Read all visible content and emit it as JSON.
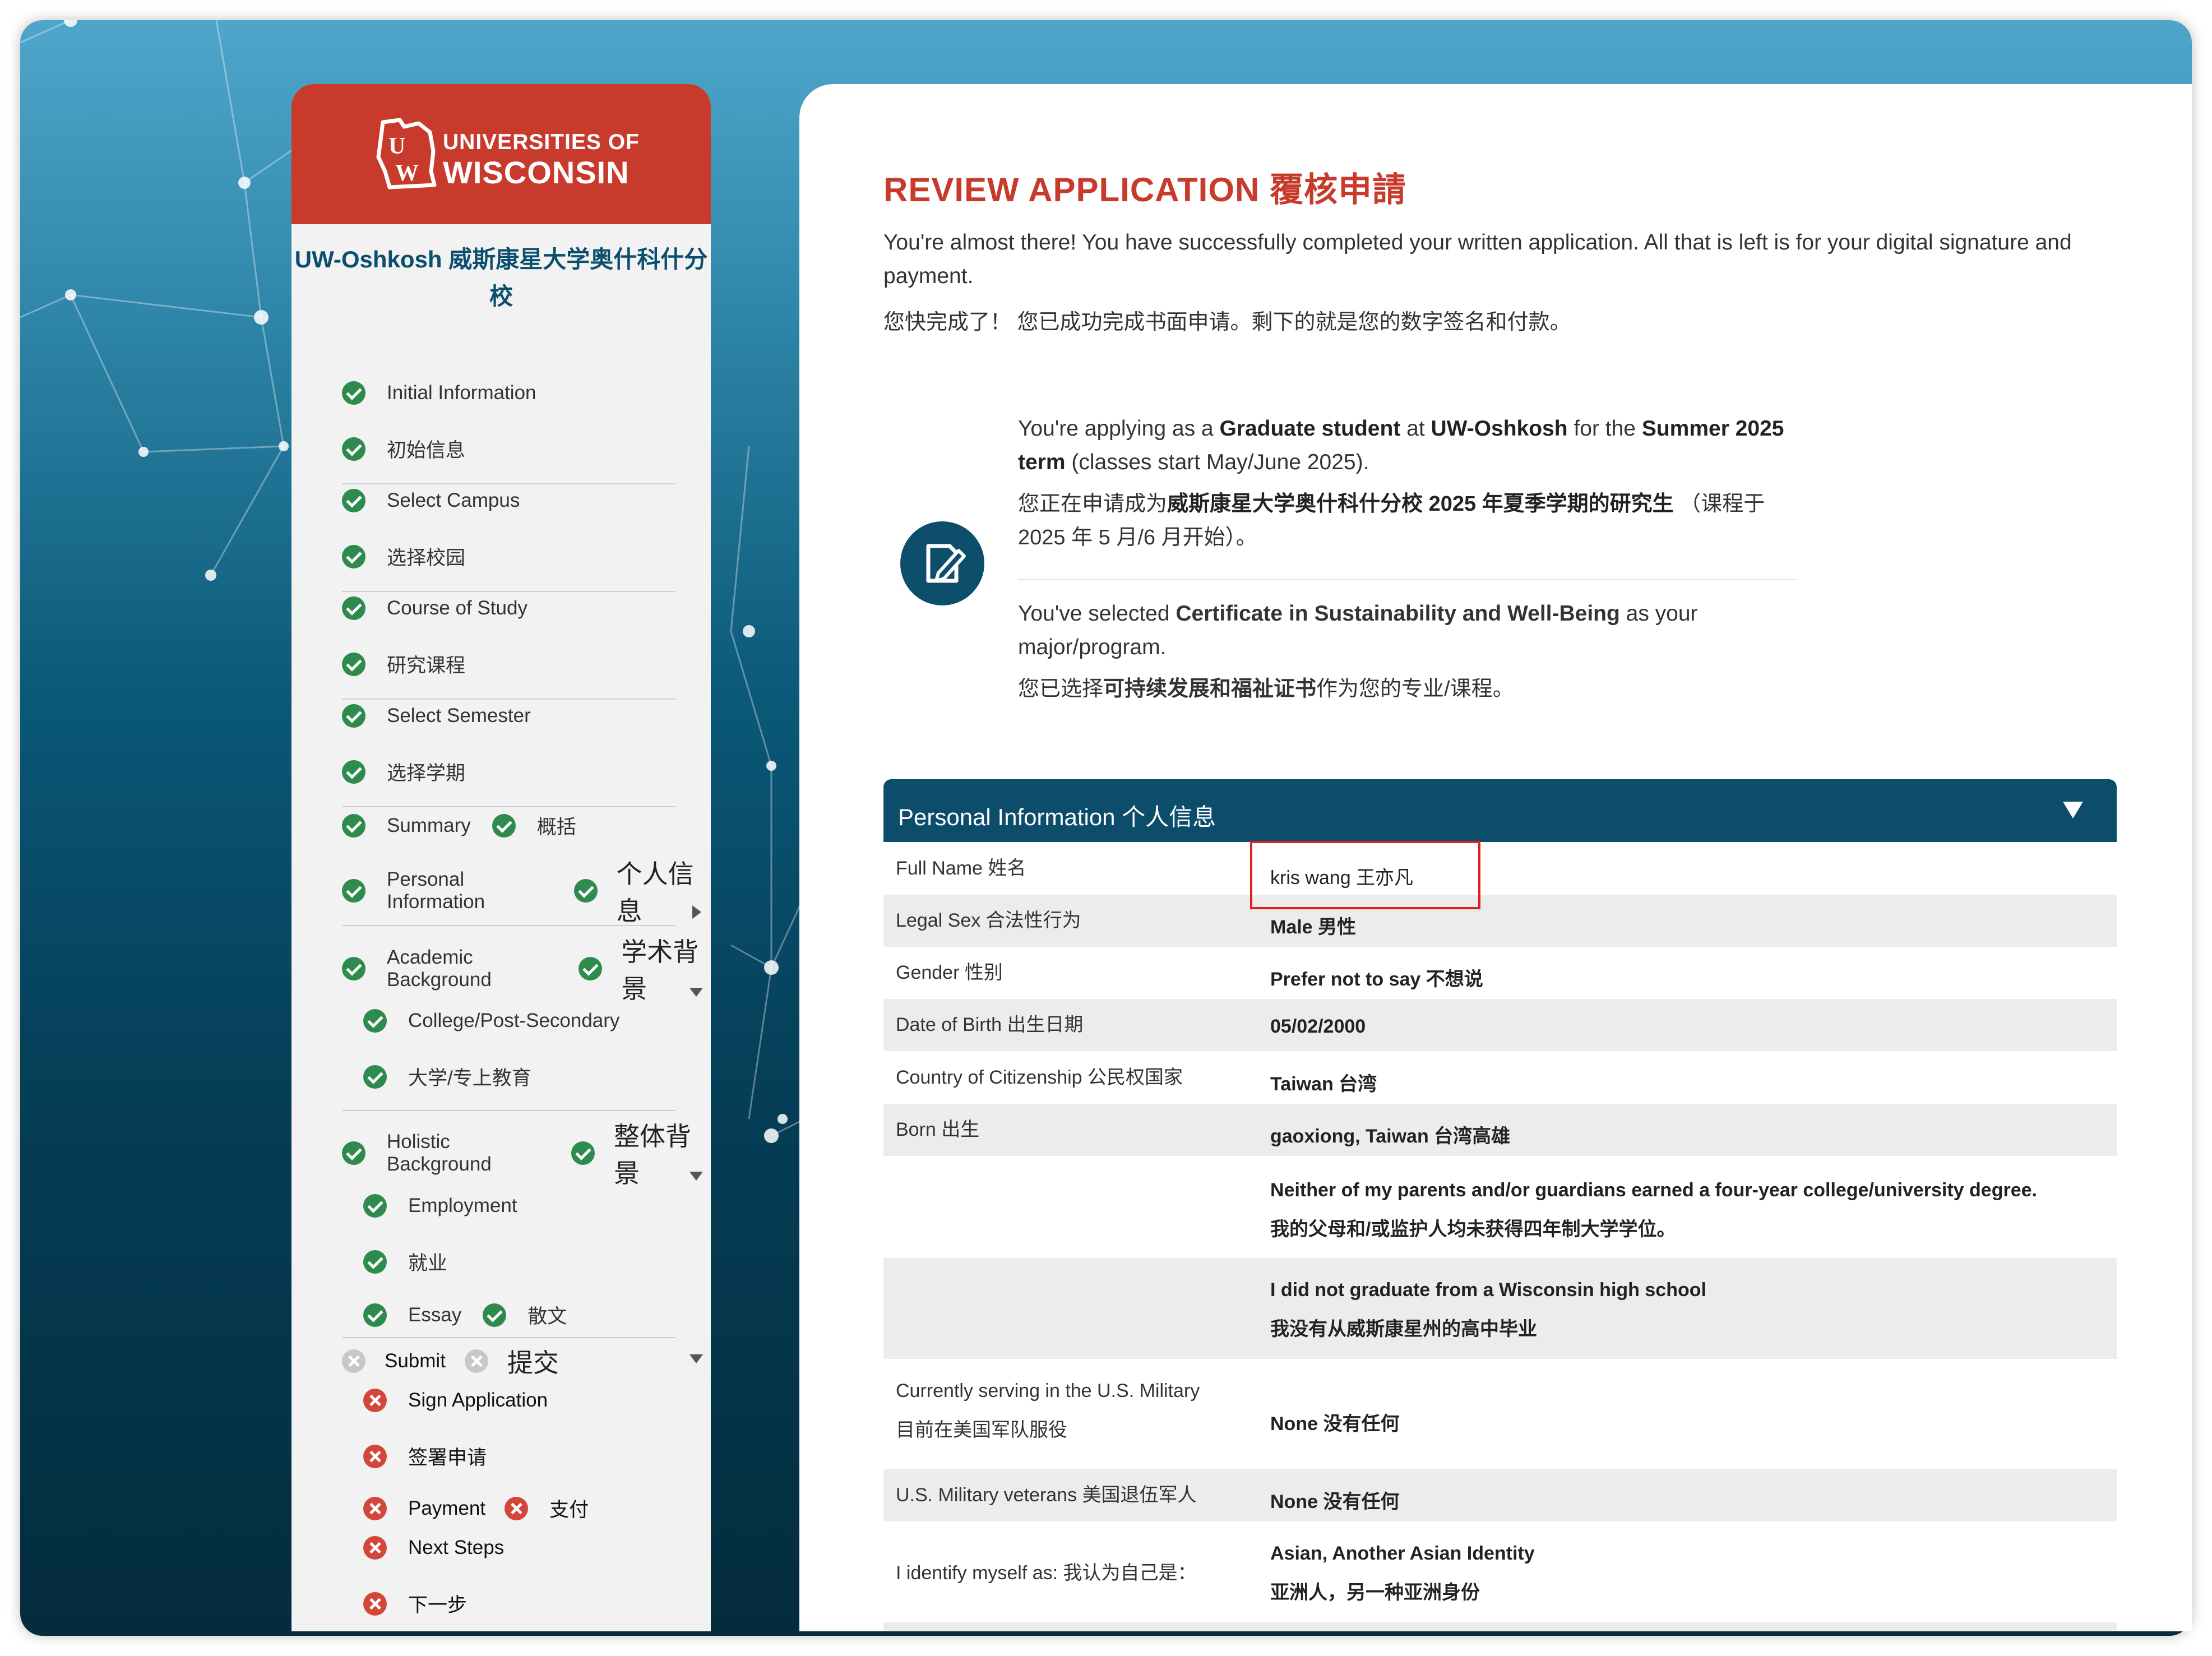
{
  "sidebar": {
    "logo": {
      "line1": "UNIVERSITIES OF",
      "line2": "WISCONSIN"
    },
    "campus_title": "UW-Oshkosh  威斯康星大学奥什科什分校",
    "steps": {
      "initial_en": "Initial Information",
      "initial_cn": "初始信息",
      "campus_en": "Select Campus",
      "campus_cn": "选择校园",
      "course_en": "Course of Study",
      "course_cn": "研究课程",
      "semester_en": "Select Semester",
      "semester_cn": "选择学期",
      "summary_en": "Summary",
      "summary_cn": "概括",
      "personal_en": "Personal Information",
      "personal_cn": "个人信息",
      "academic_en": "Academic Background",
      "academic_cn": "学术背景",
      "college_en": "College/Post-Secondary",
      "college_cn": "大学/专上教育",
      "holistic_en": "Holistic Background",
      "holistic_cn": "整体背景",
      "employment_en": "Employment",
      "employment_cn": "就业",
      "essay_en": "Essay",
      "essay_cn": "散文",
      "submit_en": "Submit",
      "submit_cn": "提交",
      "sign_en": "Sign Application",
      "sign_cn": "签署申请",
      "payment_en": "Payment",
      "payment_cn": "支付",
      "next_en": "Next Steps",
      "next_cn": "下一步"
    }
  },
  "main": {
    "title": "REVIEW APPLICATION  覆核申請",
    "intro_en": "You're almost there! You have successfully completed your written application. All that is left is for your digital signature and payment.",
    "intro_cn": "您快完成了！ 您已成功完成书面申请。剩下的就是您的数字签名和付款。",
    "apply": {
      "p1": "You're applying as a ",
      "b1": "Graduate student",
      "p2": " at ",
      "b2": "UW-Oshkosh",
      "p3": " for the ",
      "b3": "Summer 2025 term",
      "p4": " (classes start May/June 2025).",
      "cn1": "您正在申请成为",
      "cnb": "威斯康星大学奥什科什分校 2025 年夏季学期的研究生",
      "cn2": " （课程于 2025 年 5 月/6 月开始）。"
    },
    "selected": {
      "p1": "You've selected ",
      "b1": "Certificate in Sustainability and Well-Being",
      "p2": " as your major/program.",
      "cn1": "您已选择",
      "cnb": "可持续发展和福祉证书",
      "cn2": "作为您的专业/课程。"
    },
    "panel_title": "Personal Information  个人信息",
    "rows": {
      "fullname_k": "Full Name  姓名",
      "fullname_v": "kris wang   王亦凡",
      "sex_k": "Legal Sex  合法性行为",
      "sex_v": "Male  男性",
      "gender_k": "Gender  性别",
      "gender_v": "Prefer not to say  不想说",
      "dob_k": "Date of Birth  出生日期",
      "dob_v": "05/02/2000",
      "citizen_k": "Country of Citizenship  公民权国家",
      "citizen_v": "Taiwan  台湾",
      "born_k": "Born  出生",
      "born_v": "gaoxiong, Taiwan  台湾高雄",
      "parents_en": "Neither of my parents and/or guardians earned a four-year college/university degree.",
      "parents_cn": "我的父母和/或监护人均未获得四年制大学学位。",
      "hs_en": "I did not graduate from a Wisconsin high school",
      "hs_cn": "我没有从威斯康星州的高中毕业",
      "military_k1": "Currently serving in the U.S. Military",
      "military_k2": "目前在美国军队服役",
      "military_v": "None  没有任何",
      "veteran_k": "U.S. Military veterans  美国退伍军人",
      "veteran_v": "None  没有任何",
      "identify_k": "I identify myself as:  我认为自己是：",
      "identify_v1": "Asian, Another Asian Identity",
      "identify_v2": "亚洲人，另一种亚洲身份"
    }
  },
  "colors": {
    "brand_red": "#c83b2c",
    "navy": "#0b4d6b",
    "success": "#2e8b4e",
    "error": "#d2473a"
  }
}
